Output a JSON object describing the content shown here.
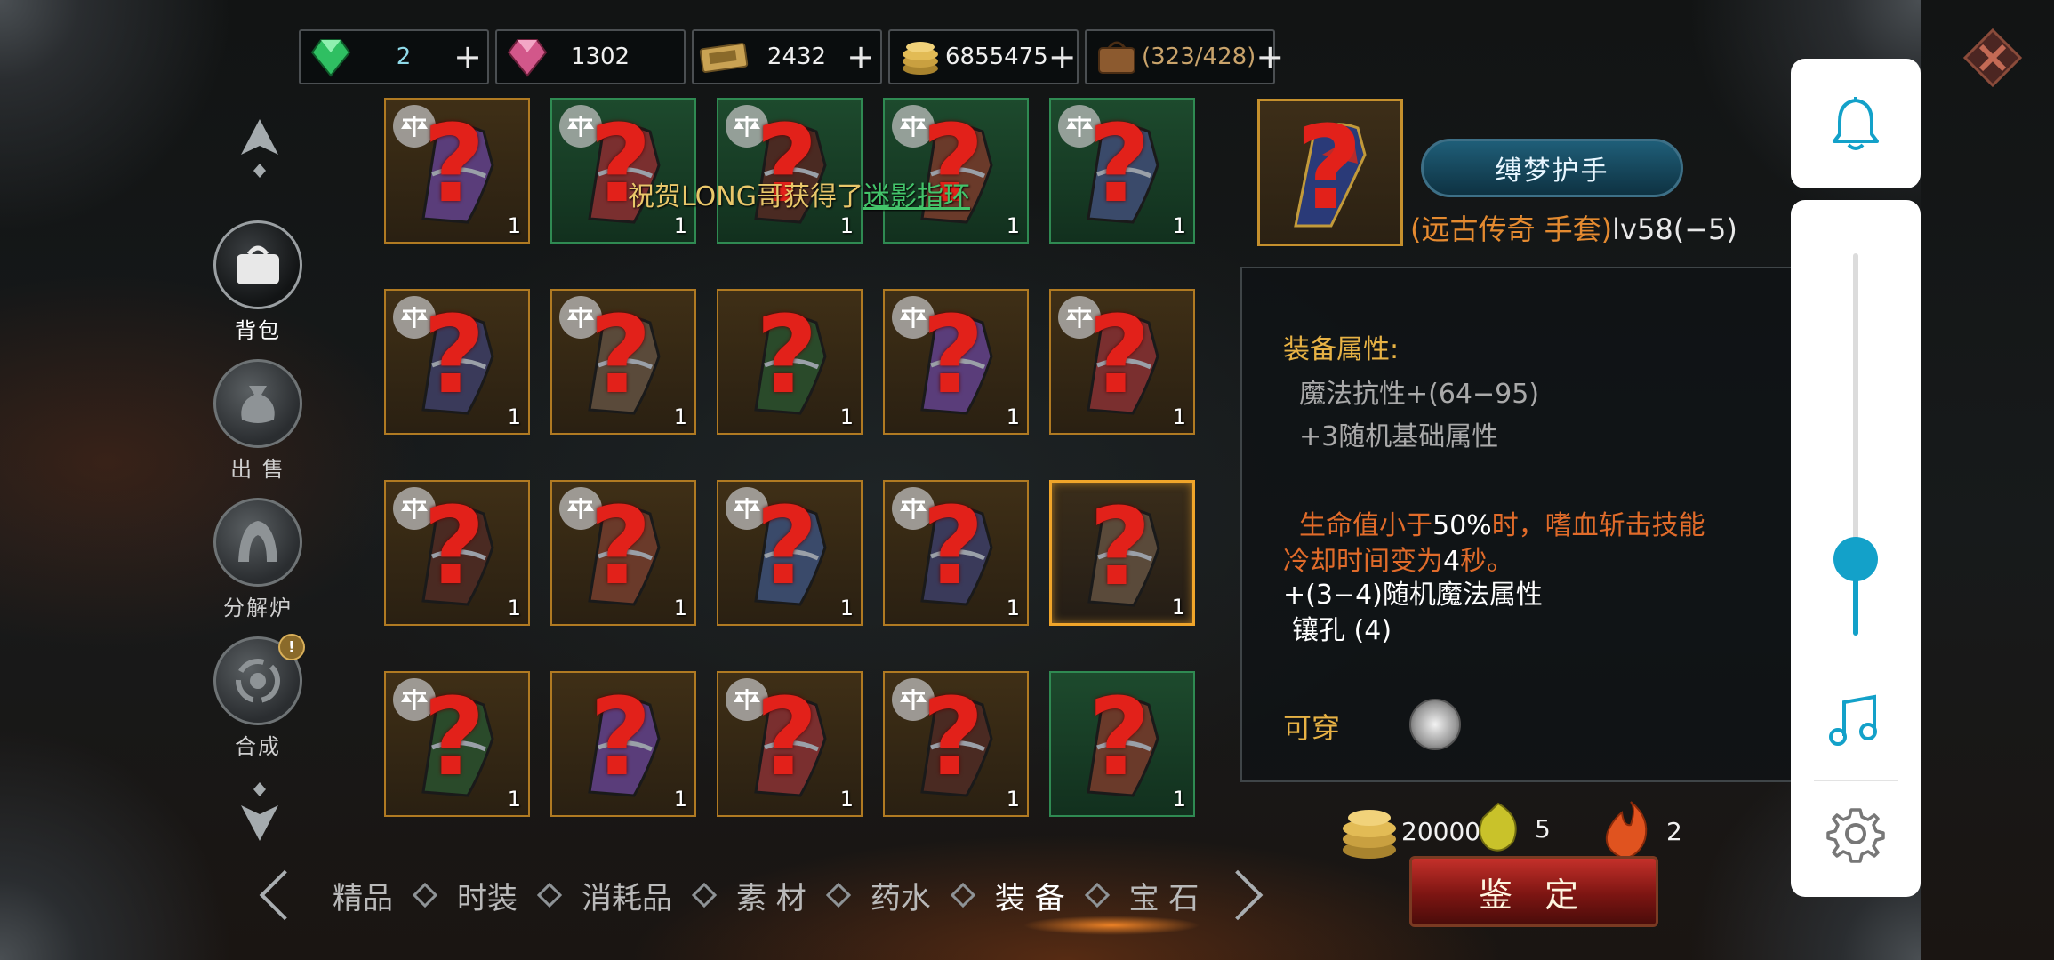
{
  "currencies": [
    {
      "name": "emerald",
      "value": "2",
      "color": "#8fd9e8"
    },
    {
      "name": "ruby",
      "value": "1302",
      "color": "#f0f0f0"
    },
    {
      "name": "ticket",
      "value": "2432",
      "color": "#f0f0f0"
    },
    {
      "name": "gold",
      "value": "6855475",
      "color": "#f0f0f0"
    },
    {
      "name": "bag",
      "value": "(323/428)",
      "color": "#c9a36b"
    }
  ],
  "plus_label": "+",
  "left_nav": [
    {
      "label": "背包",
      "icon": "bag-icon",
      "active": true
    },
    {
      "label": "出 售",
      "icon": "sell-icon",
      "active": false
    },
    {
      "label": "分解炉",
      "icon": "furnace-icon",
      "active": false
    },
    {
      "label": "合成",
      "icon": "synthesis-icon",
      "active": false,
      "badge": "!"
    }
  ],
  "grid": [
    {
      "style": "orange",
      "count": "1",
      "scale": true
    },
    {
      "style": "green",
      "count": "1",
      "scale": true
    },
    {
      "style": "green",
      "count": "1",
      "scale": true
    },
    {
      "style": "green",
      "count": "1",
      "scale": true
    },
    {
      "style": "green",
      "count": "1",
      "scale": true
    },
    {
      "style": "orange",
      "count": "1",
      "scale": true
    },
    {
      "style": "orange",
      "count": "1",
      "scale": true
    },
    {
      "style": "orange",
      "count": "1",
      "scale": false
    },
    {
      "style": "orange",
      "count": "1",
      "scale": true
    },
    {
      "style": "orange",
      "count": "1",
      "scale": true
    },
    {
      "style": "orange",
      "count": "1",
      "scale": true
    },
    {
      "style": "orange",
      "count": "1",
      "scale": true
    },
    {
      "style": "orange",
      "count": "1",
      "scale": true
    },
    {
      "style": "orange",
      "count": "1",
      "scale": true
    },
    {
      "style": "selected",
      "count": "1",
      "scale": false
    },
    {
      "style": "orange",
      "count": "1",
      "scale": true
    },
    {
      "style": "orange",
      "count": "1",
      "scale": false
    },
    {
      "style": "orange",
      "count": "1",
      "scale": true
    },
    {
      "style": "orange",
      "count": "1",
      "scale": true
    },
    {
      "style": "green",
      "count": "1",
      "scale": false
    }
  ],
  "announcement": {
    "prefix": "祝贺LONG哥获得了",
    "item": "迷影指环"
  },
  "detail": {
    "name": "缚梦护手",
    "subtitle_quality": "(远古传奇 手套)",
    "subtitle_level": "lv58(−5)",
    "section_title": "装备属性:",
    "attr1": "魔法抗性+(64−95)",
    "attr2": "+3随机基础属性",
    "effect1_a": "生命值小于",
    "effect1_b": "50%",
    "effect1_c": "时，嗜血斩击技能",
    "effect2_a": "冷却时间变为",
    "effect2_b": "4",
    "effect2_c": "秒。",
    "attr3": "+(3−4)随机魔法属性",
    "attr4": "镶孔 (4)",
    "wearable": "可穿"
  },
  "costs": [
    {
      "name": "gold",
      "value": "20000"
    },
    {
      "name": "crystal",
      "value": "5"
    },
    {
      "name": "fire-essence",
      "value": "2"
    }
  ],
  "identify_button": "鉴 定",
  "tabs": [
    {
      "label": "精品",
      "active": false
    },
    {
      "label": "时装",
      "active": false
    },
    {
      "label": "消耗品",
      "active": false
    },
    {
      "label": "素 材",
      "active": false
    },
    {
      "label": "药水",
      "active": false
    },
    {
      "label": "装 备",
      "active": true
    },
    {
      "label": "宝 石",
      "active": false
    }
  ],
  "volume_level": 0.14,
  "accent": "#13a1c9"
}
